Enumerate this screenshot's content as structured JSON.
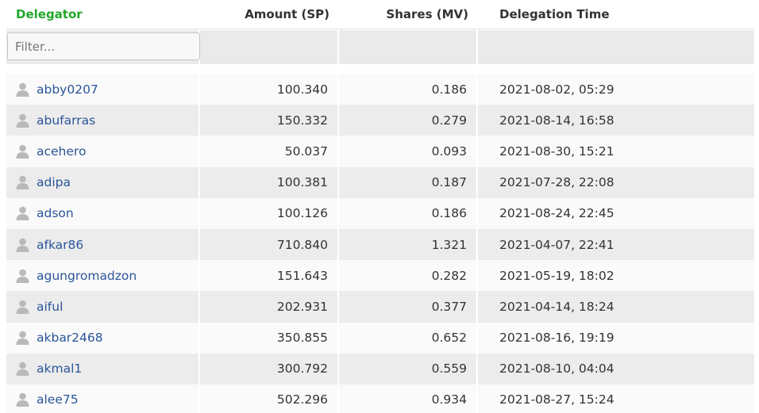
{
  "header": {
    "delegator": "Delegator",
    "amount": "Amount (SP)",
    "shares": "Shares (MV)",
    "time": "Delegation Time"
  },
  "filter": {
    "placeholder": "Filter..."
  },
  "rows": [
    {
      "name": "abby0207",
      "amount": "100.340",
      "shares": "0.186",
      "time": "2021-08-02, 05:29"
    },
    {
      "name": "abufarras",
      "amount": "150.332",
      "shares": "0.279",
      "time": "2021-08-14, 16:58"
    },
    {
      "name": "acehero",
      "amount": "50.037",
      "shares": "0.093",
      "time": "2021-08-30, 15:21"
    },
    {
      "name": "adipa",
      "amount": "100.381",
      "shares": "0.187",
      "time": "2021-07-28, 22:08"
    },
    {
      "name": "adson",
      "amount": "100.126",
      "shares": "0.186",
      "time": "2021-08-24, 22:45"
    },
    {
      "name": "afkar86",
      "amount": "710.840",
      "shares": "1.321",
      "time": "2021-04-07, 22:41"
    },
    {
      "name": "agungromadzon",
      "amount": "151.643",
      "shares": "0.282",
      "time": "2021-05-19, 18:02"
    },
    {
      "name": "aiful",
      "amount": "202.931",
      "shares": "0.377",
      "time": "2021-04-14, 18:24"
    },
    {
      "name": "akbar2468",
      "amount": "350.855",
      "shares": "0.652",
      "time": "2021-08-16, 19:19"
    },
    {
      "name": "akmal1",
      "amount": "300.792",
      "shares": "0.559",
      "time": "2021-08-10, 04:04"
    },
    {
      "name": "alee75",
      "amount": "502.296",
      "shares": "0.934",
      "time": "2021-08-27, 15:24"
    }
  ],
  "colors": {
    "sort_header": "#22a72a",
    "link": "#2a5599",
    "row_even": "#ececec",
    "row_odd": "#fafafa"
  }
}
